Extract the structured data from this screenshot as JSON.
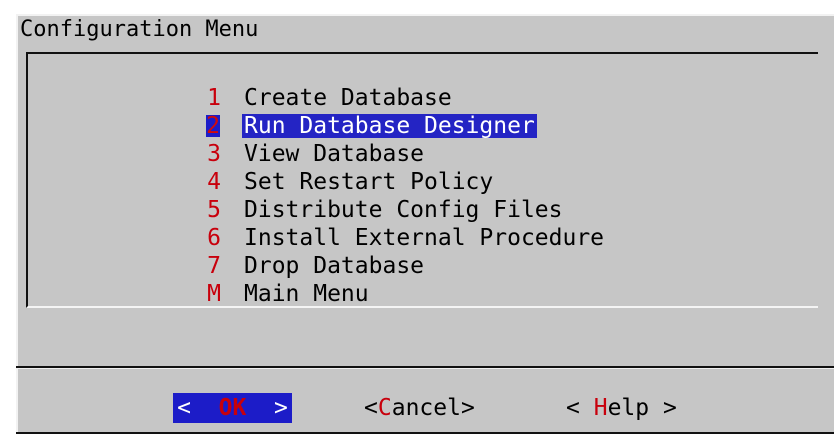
{
  "dialog": {
    "title": "Configuration Menu"
  },
  "menu": {
    "items": [
      {
        "key": "1",
        "label": "Create Database",
        "selected": false
      },
      {
        "key": "2",
        "label": "Run Database Designer",
        "selected": true
      },
      {
        "key": "3",
        "label": "View Database",
        "selected": false
      },
      {
        "key": "4",
        "label": "Set Restart Policy",
        "selected": false
      },
      {
        "key": "5",
        "label": "Distribute Config Files",
        "selected": false
      },
      {
        "key": "6",
        "label": "Install External Procedure",
        "selected": false
      },
      {
        "key": "7",
        "label": "Drop Database",
        "selected": false
      },
      {
        "key": "M",
        "label": "Main Menu",
        "selected": false
      }
    ]
  },
  "buttons": {
    "ok": {
      "prefix": "<  ",
      "hot": "OK",
      "suffix": "  >",
      "focused": true
    },
    "cancel": {
      "prefix": "<",
      "hot": "C",
      "suffix": "ancel>",
      "focused": false
    },
    "help": {
      "prefix": "< ",
      "hot": "H",
      "suffix": "elp >",
      "focused": false
    }
  },
  "colors": {
    "background": "#c6c6c6",
    "highlight": "#1c1cc8",
    "hotkey": "#c8000c",
    "ok_hotkey": "#ffe400"
  }
}
